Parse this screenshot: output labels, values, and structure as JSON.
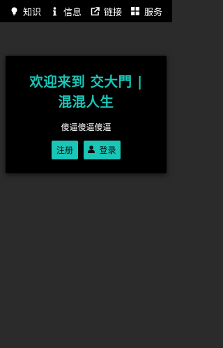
{
  "nav": {
    "items": [
      {
        "label": "知识",
        "icon": "lightbulb-icon"
      },
      {
        "label": "信息",
        "icon": "info-icon"
      },
      {
        "label": "链接",
        "icon": "external-link-icon"
      },
      {
        "label": "服务",
        "icon": "grid-icon"
      }
    ]
  },
  "hero": {
    "line1": "欢迎来到 交大門 |",
    "line2": "混混人生",
    "tagline": "傻逼傻逼傻逼"
  },
  "buttons": {
    "register_label": "注册",
    "login_label": "登录",
    "login_icon": "user-icon"
  },
  "colors": {
    "accent": "#19c6b8",
    "background": "#2b2b2b",
    "nav_background": "#000000",
    "card_background": "#000000"
  }
}
